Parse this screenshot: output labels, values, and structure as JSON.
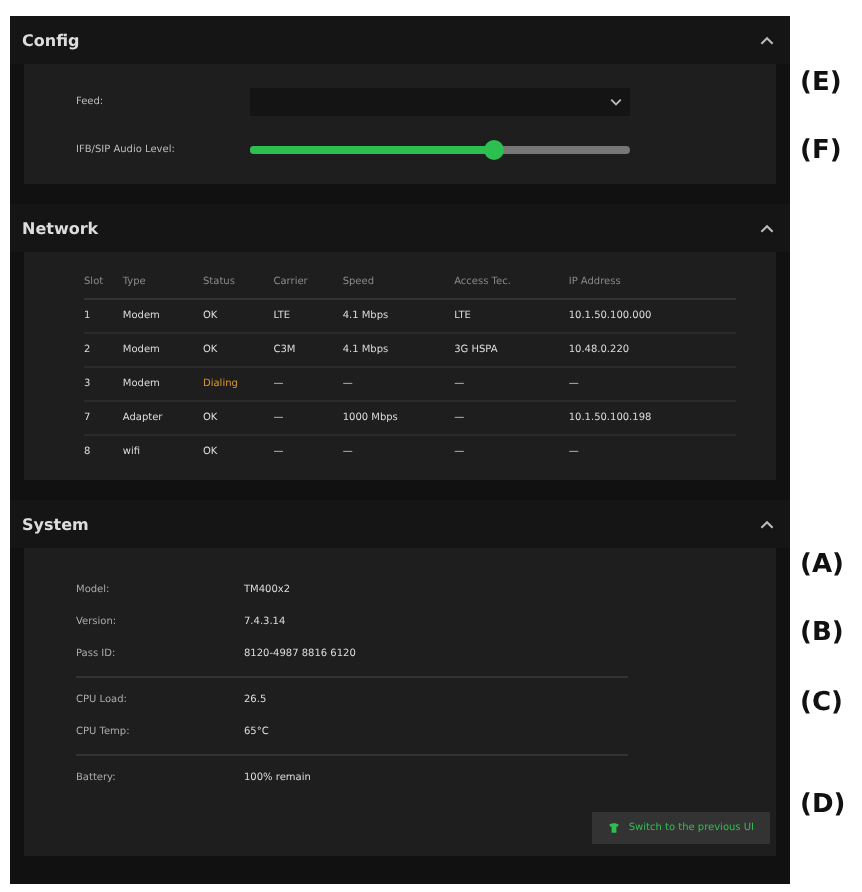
{
  "config": {
    "title": "Config",
    "expanded": true,
    "feed": {
      "label": "Feed:"
    },
    "audio": {
      "label": "IFB/SIP Audio Level:",
      "level": 0.64
    }
  },
  "network": {
    "title": "Network",
    "expanded": true,
    "columns": [
      "Slot",
      "Type",
      "Status",
      "Carrier",
      "Speed",
      "Access Tec.",
      "IP Address"
    ],
    "rows": [
      {
        "cells": [
          "1",
          "Modem",
          "OK",
          "LTE",
          "4.1 Mbps",
          "LTE",
          "10.1.50.100.000"
        ],
        "warning": false
      },
      {
        "cells": [
          "2",
          "Modem",
          "OK",
          "C3M",
          "4.1 Mbps",
          "3G HSPA",
          "10.48.0.220"
        ],
        "warning": false
      },
      {
        "cells": [
          "3",
          "Modem",
          "Dialing",
          "—",
          "—",
          "—",
          "—"
        ],
        "warning": true
      },
      {
        "cells": [
          "7",
          "Adapter",
          "OK",
          "—",
          "1000 Mbps",
          "—",
          "10.1.50.100.198"
        ],
        "warning": false
      },
      {
        "cells": [
          "8",
          "wifi",
          "OK",
          "—",
          "—",
          "—",
          "—"
        ],
        "warning": false
      }
    ]
  },
  "system": {
    "title": "System",
    "expanded": true,
    "groups": [
      [
        {
          "label": "Model:",
          "value": "TM400x2"
        },
        {
          "label": "Version:",
          "value": "7.4.3.14"
        },
        {
          "label": "Pass ID:",
          "value": "8120-4987 8816 6120"
        }
      ],
      [
        {
          "label": "CPU Load:",
          "value": "26.5"
        },
        {
          "label": "CPU Temp:",
          "value": "65°C"
        }
      ],
      [
        {
          "label": "Battery:",
          "value": "100% remain"
        }
      ]
    ],
    "button": "Switch to the previous UI"
  },
  "annotations": [
    "(E)",
    "(F)",
    "(A)",
    "(B)",
    "(C)",
    "(D)"
  ]
}
